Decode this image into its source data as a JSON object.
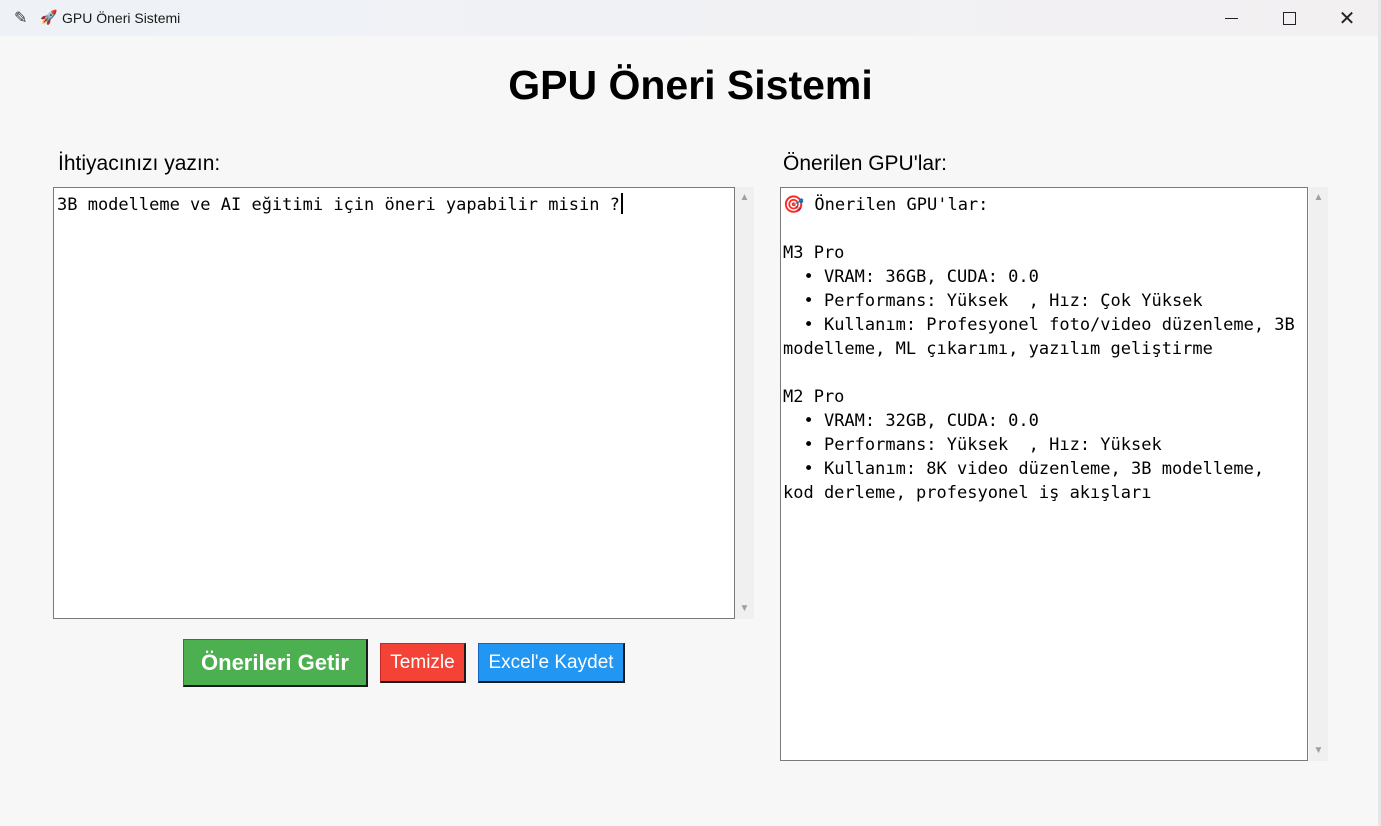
{
  "window": {
    "title": "GPU Öneri Sistemi",
    "title_icon": "rocket-icon",
    "app_icon": "feather-icon",
    "controls": {
      "minimize": "minimize-icon",
      "maximize": "maximize-icon",
      "close": "✕"
    }
  },
  "app": {
    "title": "GPU Öneri Sistemi",
    "input_label": "İhtiyacınızı yazın:",
    "output_label": "Önerilen GPU'lar:",
    "input_value": "3B modelleme ve AI eğitimi için öneri yapabilir misin ?",
    "output_value": "🎯 Önerilen GPU'lar:\n\nM3 Pro\n  • VRAM: 36GB, CUDA: 0.0\n  • Performans: Yüksek  , Hız: Çok Yüksek\n  • Kullanım: Profesyonel foto/video düzenleme, 3B modelleme, ML çıkarımı, yazılım geliştirme\n\nM2 Pro\n  • VRAM: 32GB, CUDA: 0.0\n  • Performans: Yüksek  , Hız: Yüksek\n  • Kullanım: 8K video düzenleme, 3B modelleme, kod derleme, profesyonel iş akışları"
  },
  "buttons": {
    "get": "Önerileri Getir",
    "clear": "Temizle",
    "excel": "Excel'e Kaydet"
  },
  "colors": {
    "get_button": "#4caf50",
    "clear_button": "#f44336",
    "excel_button": "#2196f3"
  }
}
